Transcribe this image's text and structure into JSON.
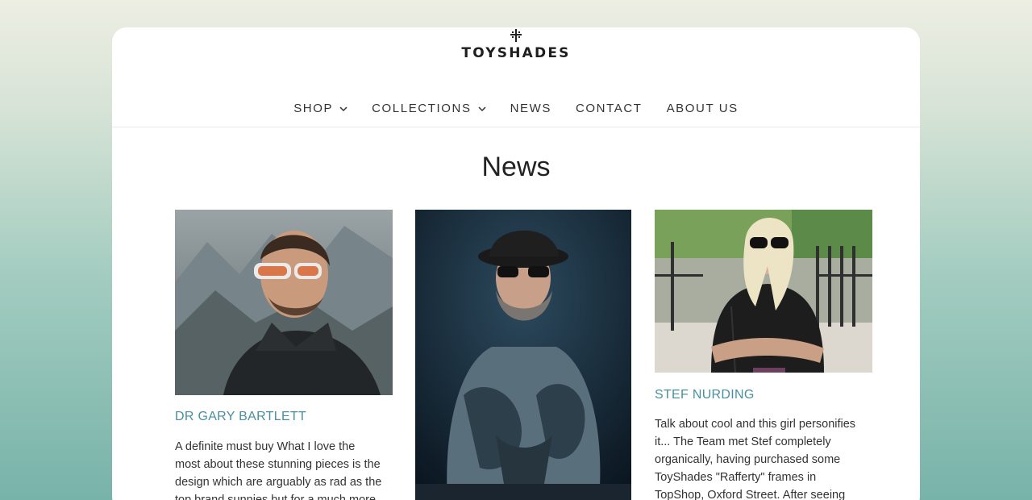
{
  "brand": {
    "name": "TOYSHADES",
    "logo_icon": "cross-ornament-icon"
  },
  "nav": {
    "items": [
      {
        "label": "SHOP",
        "has_dropdown": true
      },
      {
        "label": "COLLECTIONS",
        "has_dropdown": true
      },
      {
        "label": "NEWS",
        "has_dropdown": false
      },
      {
        "label": "CONTACT",
        "has_dropdown": false
      },
      {
        "label": "ABOUT US",
        "has_dropdown": false
      }
    ]
  },
  "page": {
    "title": "News"
  },
  "posts": [
    {
      "title": "DR GARY BARTLETT",
      "excerpt_lines": [
        "A definite must buy   What I love the",
        "most about these stunning pieces is the",
        "design which are arguably as rad as the",
        "top brand sunnies but for a much more"
      ]
    },
    {
      "title": "",
      "excerpt_lines": []
    },
    {
      "title": "STEF NURDING",
      "excerpt_lines": [
        "Talk about cool and this girl personifies",
        "it... The Team met Stef completely",
        "organically, having purchased some",
        "ToyShades \"Rafferty\" frames in",
        "TopShop, Oxford Street. After seeing"
      ]
    }
  ],
  "colors": {
    "accent": "#4a8fa0",
    "text": "#333333",
    "background_top": "#eeeee3",
    "background_bottom": "#78b3a9"
  }
}
